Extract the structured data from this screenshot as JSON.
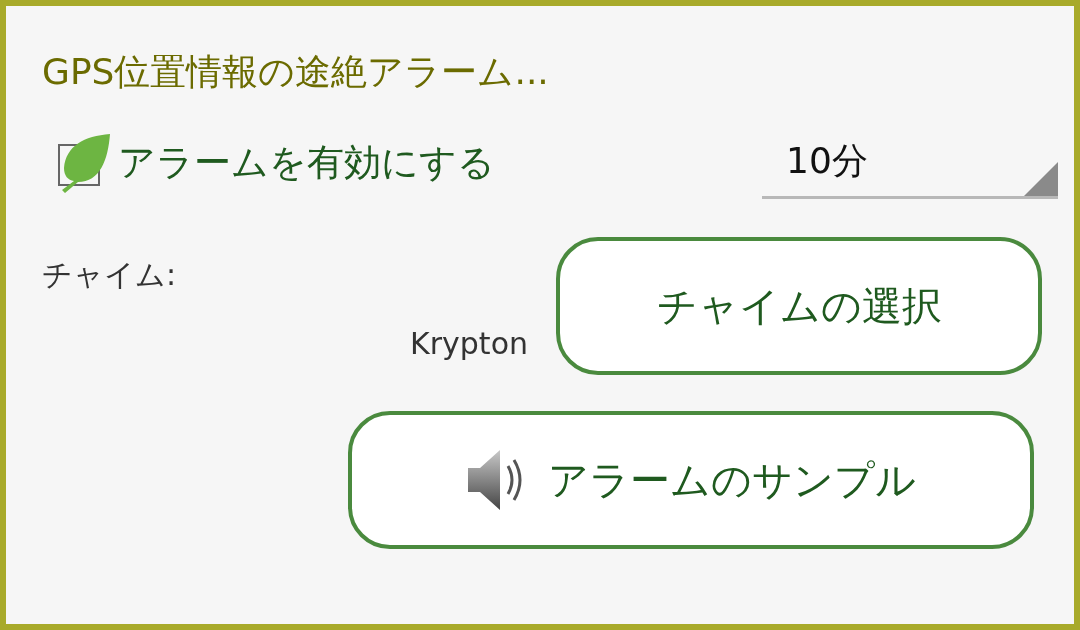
{
  "title": "GPS位置情報の途絶アラーム...",
  "enable": {
    "label": "アラームを有効にする",
    "checked": false
  },
  "interval": {
    "value": "10分"
  },
  "chime": {
    "label": "チャイム:",
    "value": "Krypton",
    "button": "チャイムの選択"
  },
  "sample_button": "アラームのサンプル"
}
